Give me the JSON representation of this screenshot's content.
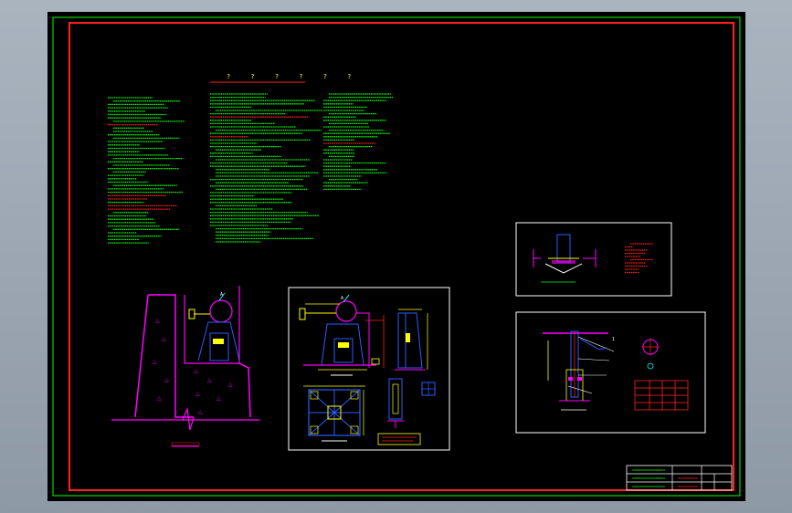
{
  "drawing": {
    "colors": {
      "background": "#000000",
      "frame_outer": "#00ff00",
      "frame_inner": "#ff2020",
      "text_green": "#00ff00",
      "text_red": "#ff2020",
      "dim_yellow": "#ffff00",
      "struct_magenta": "#ff00ff",
      "steel_blue": "#2d5bff",
      "white": "#ffffff",
      "cyan": "#00ffff"
    },
    "notes_title": "? ? ? ? ? ?",
    "detail_callout": "A",
    "detail_callout_b": "1"
  }
}
